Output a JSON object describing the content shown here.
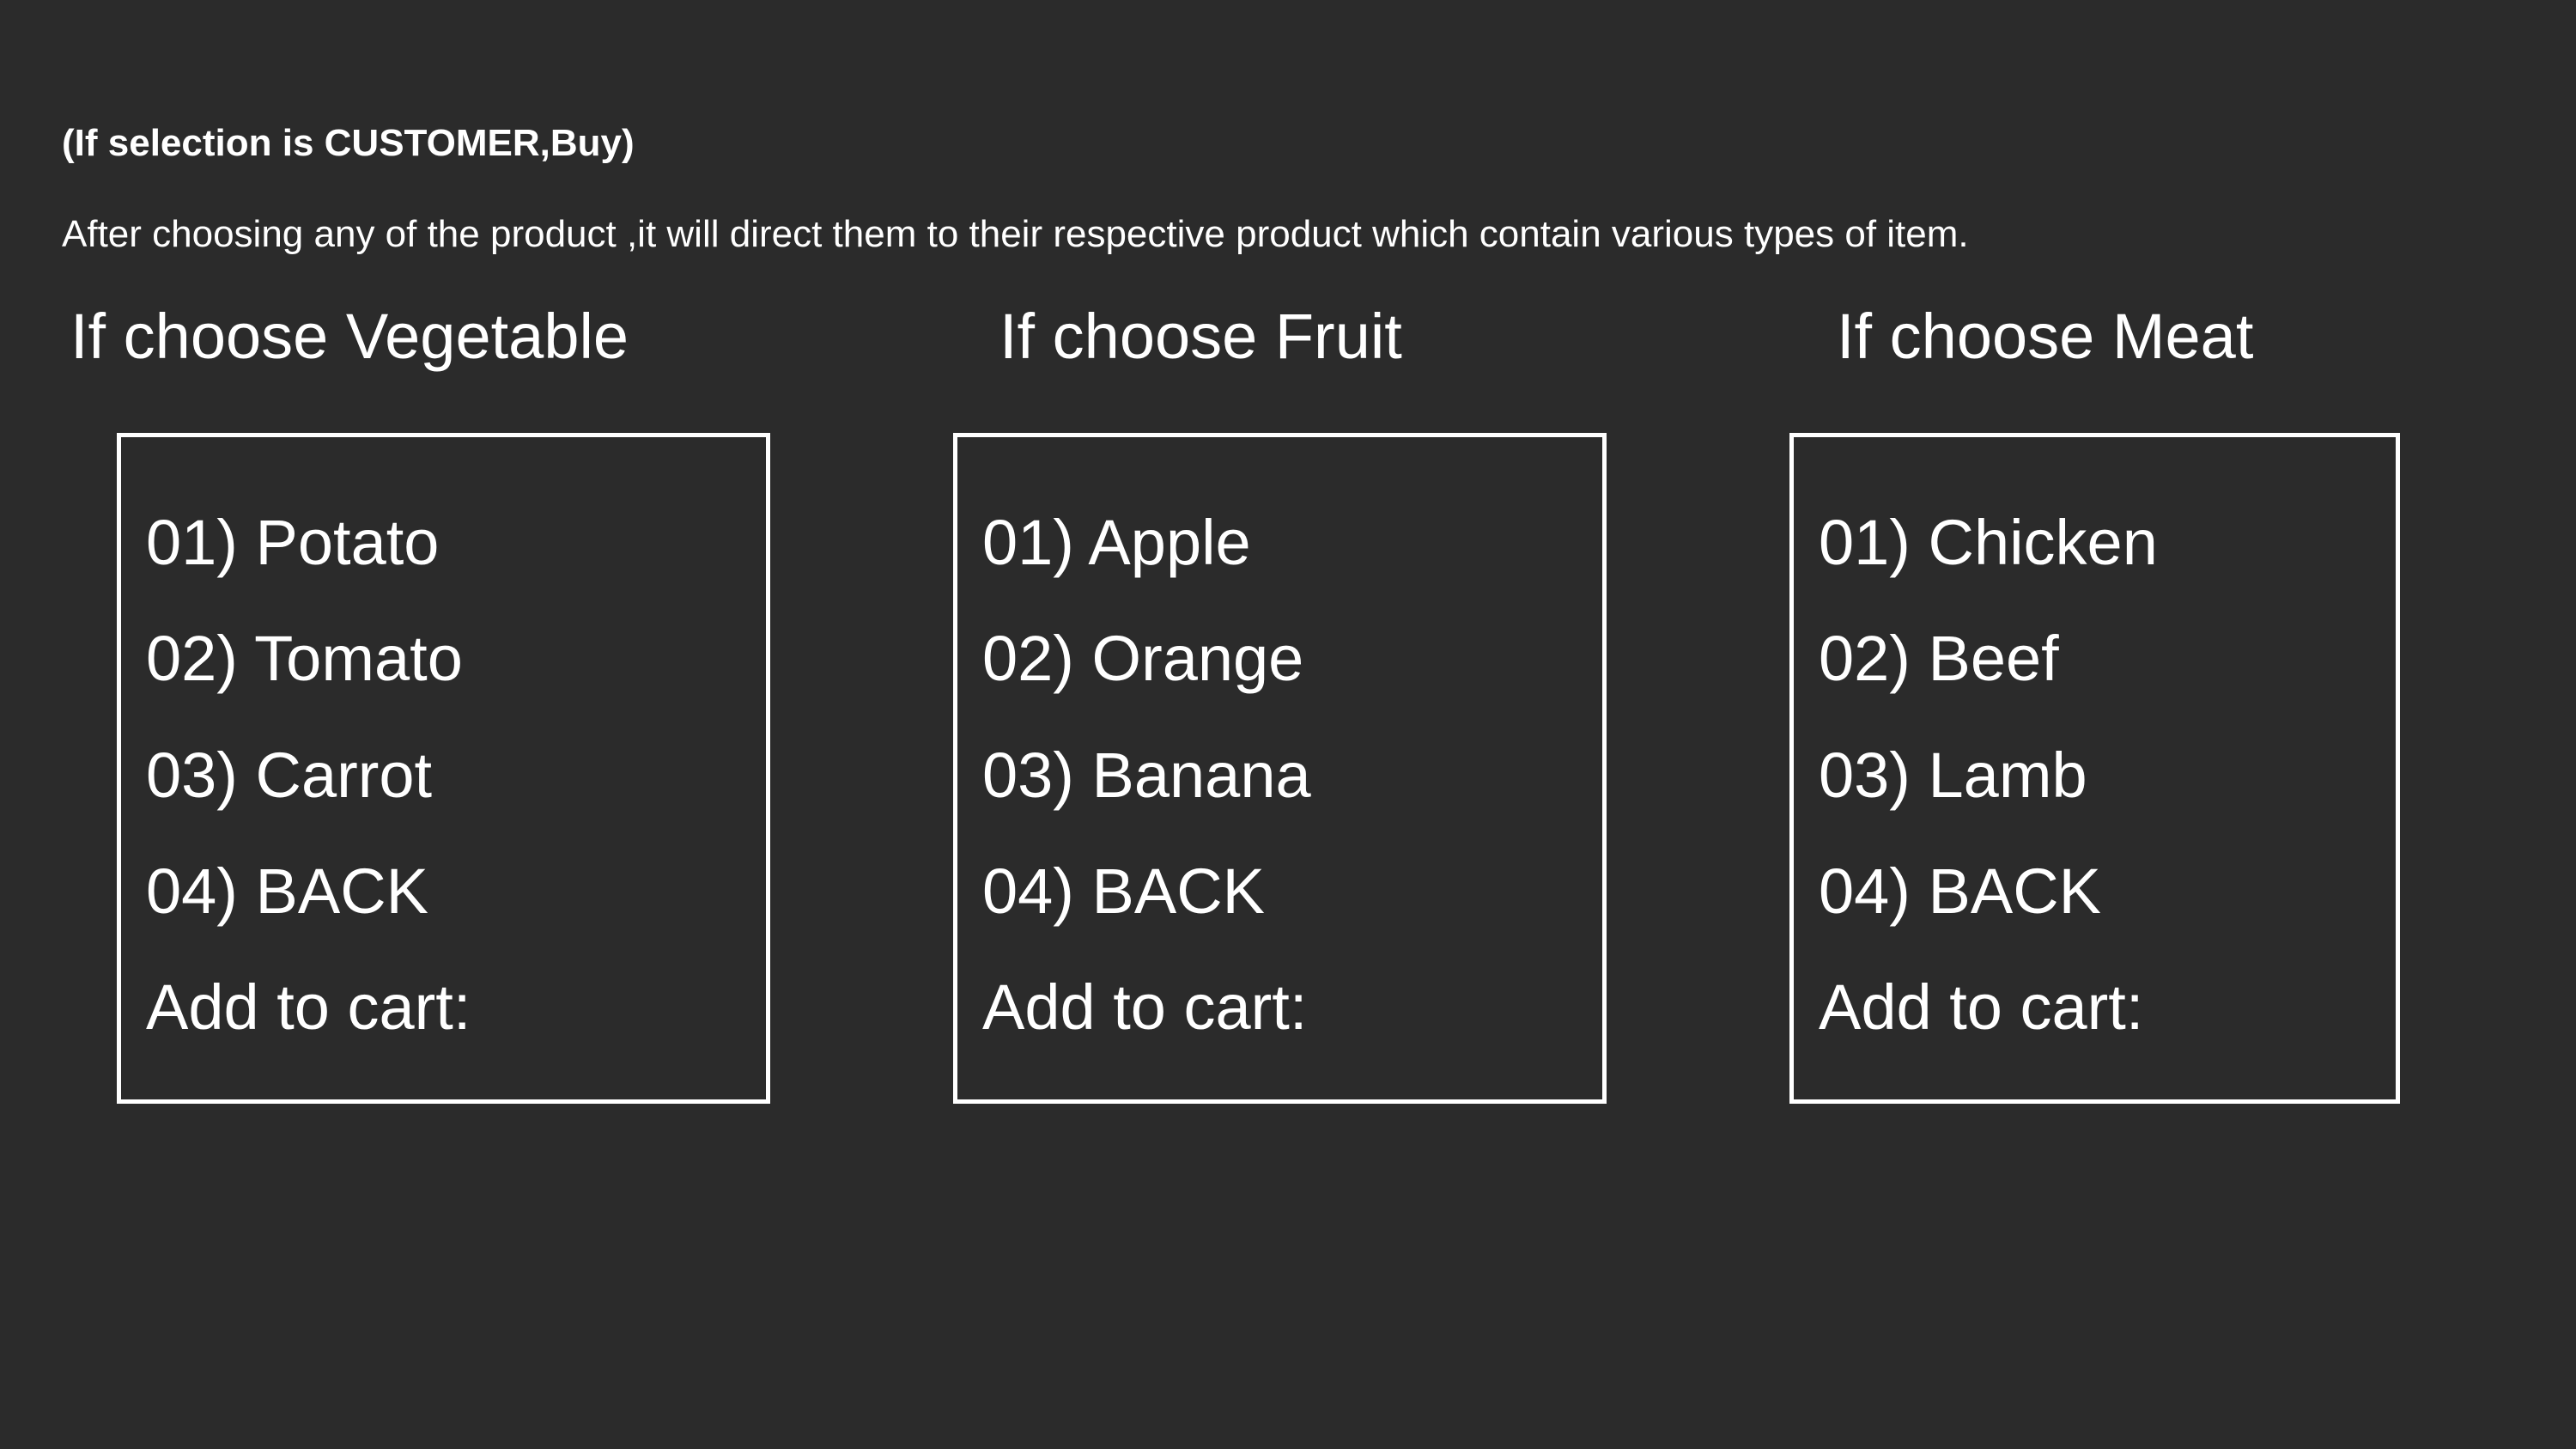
{
  "heading": "(If selection is CUSTOMER,Buy)",
  "description": "After choosing any of the product ,it will direct them to their respective product which contain various types of item.",
  "columns": [
    {
      "title": "If choose Vegetable",
      "items": [
        "01) Potato",
        "02) Tomato",
        "03) Carrot",
        "04) BACK"
      ],
      "prompt": "Add to cart:"
    },
    {
      "title": "If choose Fruit",
      "items": [
        "01) Apple",
        "02) Orange",
        "03) Banana",
        "04) BACK"
      ],
      "prompt": "Add to cart:"
    },
    {
      "title": "If choose Meat",
      "items": [
        "01) Chicken",
        "02) Beef",
        "03) Lamb",
        "04) BACK"
      ],
      "prompt": "Add to cart:"
    }
  ]
}
